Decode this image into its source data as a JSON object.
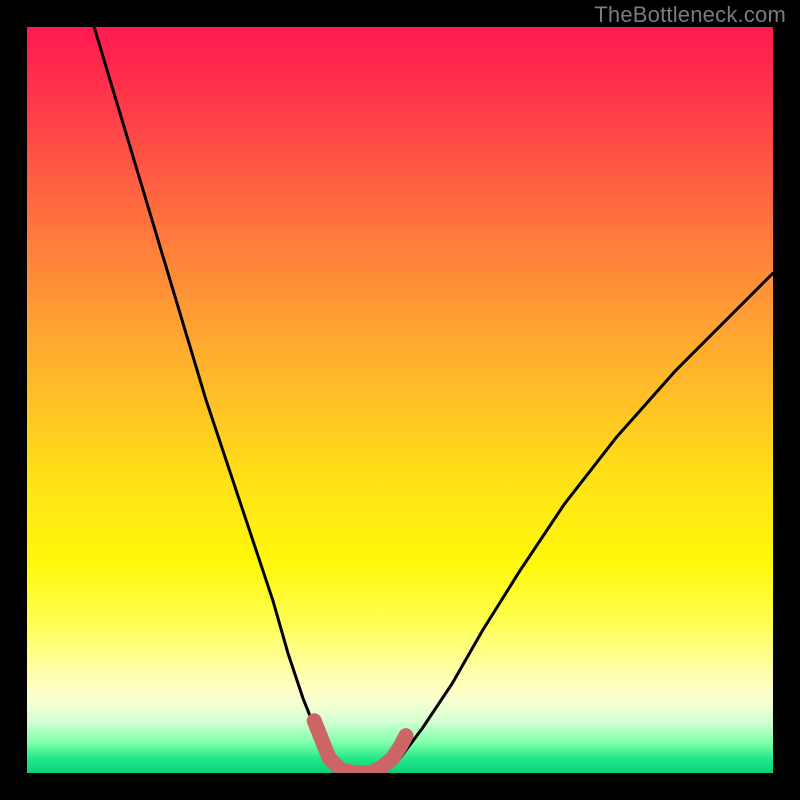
{
  "watermark": "TheBottleneck.com",
  "chart_data": {
    "type": "line",
    "title": "",
    "xlabel": "",
    "ylabel": "",
    "x_range": [
      0,
      100
    ],
    "y_range": [
      0,
      100
    ],
    "grid": false,
    "legend": false,
    "series": [
      {
        "name": "bottleneck-curve",
        "color": "#000000",
        "x": [
          9,
          12,
          15,
          18,
          21,
          24,
          27,
          30,
          33,
          35,
          37,
          39,
          40.5,
          42,
          44,
          46,
          48,
          50,
          53,
          57,
          61,
          66,
          72,
          79,
          87,
          95,
          100
        ],
        "y": [
          100,
          90,
          80,
          70,
          60,
          50,
          41,
          32,
          23,
          16,
          10,
          5,
          2,
          0.5,
          0,
          0,
          0.5,
          2,
          6,
          12,
          19,
          27,
          36,
          45,
          54,
          62,
          67
        ]
      },
      {
        "name": "optimal-zone-highlight",
        "color": "#cc6666",
        "x": [
          38.5,
          39.5,
          40.5,
          42,
          44,
          46,
          47.5,
          49,
          50,
          50.8
        ],
        "y": [
          7,
          4.5,
          2,
          0.5,
          0,
          0,
          0.7,
          2,
          3.5,
          5
        ]
      }
    ],
    "background_gradient": {
      "orientation": "vertical",
      "stops": [
        {
          "pos": 0.0,
          "color": "#ff1a4f"
        },
        {
          "pos": 0.4,
          "color": "#ffa233"
        },
        {
          "pos": 0.72,
          "color": "#fff80a"
        },
        {
          "pos": 0.9,
          "color": "#fbffd0"
        },
        {
          "pos": 1.0,
          "color": "#0ad07a"
        }
      ]
    }
  }
}
